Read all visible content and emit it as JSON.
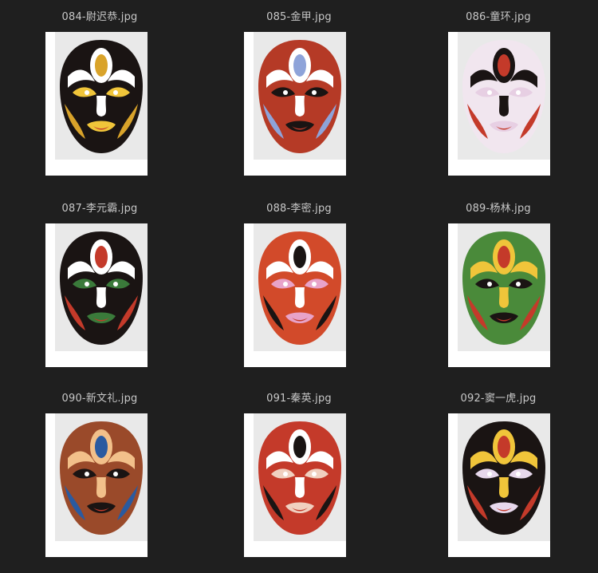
{
  "files": [
    {
      "name": "084-尉迟恭.jpg",
      "mask": "mask-084",
      "colors": {
        "base": "#1a1413",
        "paint": "#ffffff",
        "accent": "#d9a32a",
        "accent2": "#f0c53a"
      }
    },
    {
      "name": "085-金甲.jpg",
      "mask": "mask-085",
      "colors": {
        "base": "#b53a26",
        "paint": "#ffffff",
        "accent": "#8ea3d9",
        "accent2": "#1a1413"
      }
    },
    {
      "name": "086-童环.jpg",
      "mask": "mask-086",
      "colors": {
        "base": "#f1e6ef",
        "paint": "#1a1413",
        "accent": "#c43a2a",
        "accent2": "#e7cfe3"
      }
    },
    {
      "name": "087-李元霸.jpg",
      "mask": "mask-087",
      "colors": {
        "base": "#1a1413",
        "paint": "#ffffff",
        "accent": "#c43a2a",
        "accent2": "#3a7a3a"
      }
    },
    {
      "name": "088-李密.jpg",
      "mask": "mask-088",
      "colors": {
        "base": "#d24a2a",
        "paint": "#ffffff",
        "accent": "#1a1413",
        "accent2": "#e8a3c9"
      }
    },
    {
      "name": "089-杨林.jpg",
      "mask": "mask-089",
      "colors": {
        "base": "#4a8a3a",
        "paint": "#f0c53a",
        "accent": "#c43a2a",
        "accent2": "#1a1413"
      }
    },
    {
      "name": "090-新文礼.jpg",
      "mask": "mask-090",
      "colors": {
        "base": "#9a4a2a",
        "paint": "#f2c08a",
        "accent": "#2a5aa0",
        "accent2": "#1a1413"
      }
    },
    {
      "name": "091-秦英.jpg",
      "mask": "mask-091",
      "colors": {
        "base": "#c43a2a",
        "paint": "#ffffff",
        "accent": "#1a1413",
        "accent2": "#f0d0c0"
      }
    },
    {
      "name": "092-窦一虎.jpg",
      "mask": "mask-092",
      "colors": {
        "base": "#1a1413",
        "paint": "#f0c53a",
        "accent": "#c43a2a",
        "accent2": "#e7d8ec"
      }
    }
  ]
}
